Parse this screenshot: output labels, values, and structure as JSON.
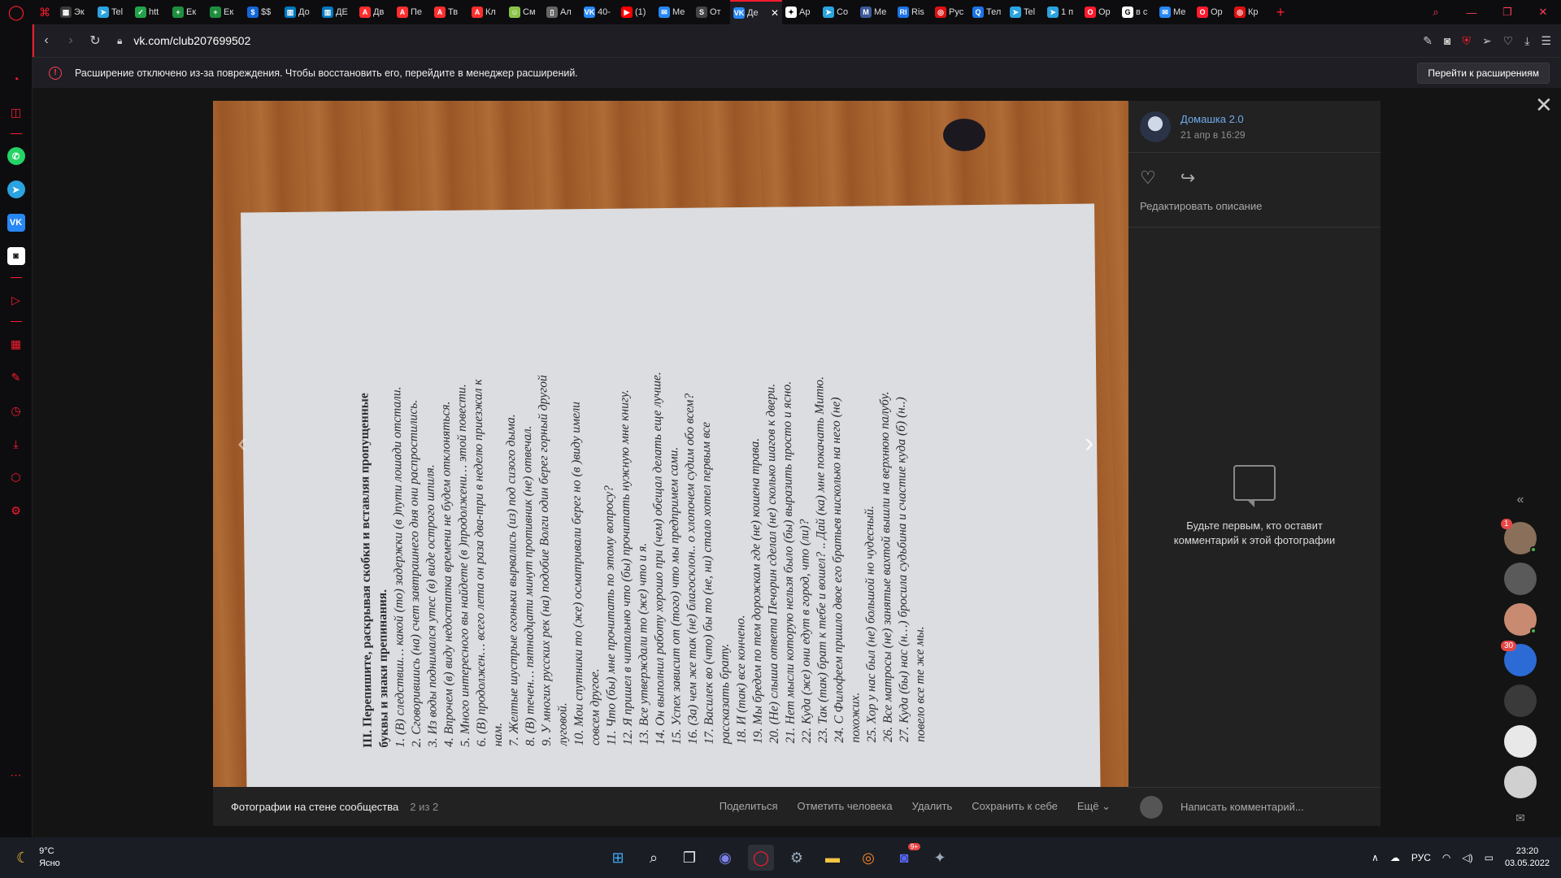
{
  "browser": {
    "tabs": [
      {
        "label": "Эк",
        "color": "#3a3a3a",
        "glyph": "▦"
      },
      {
        "label": "Tel",
        "color": "#2aa3e0",
        "glyph": "➤"
      },
      {
        "label": "htt",
        "color": "#22a34a",
        "glyph": "✓"
      },
      {
        "label": "Ек",
        "color": "#1e8e3e",
        "glyph": "+"
      },
      {
        "label": "Ек",
        "color": "#1e8e3e",
        "glyph": "+"
      },
      {
        "label": "$$",
        "color": "#1467d8",
        "glyph": "$"
      },
      {
        "label": "До",
        "color": "#0079bf",
        "glyph": "▥"
      },
      {
        "label": "ДЕ",
        "color": "#0079bf",
        "glyph": "▥"
      },
      {
        "label": "Дв",
        "color": "#ff2d2d",
        "glyph": "A"
      },
      {
        "label": "Пе",
        "color": "#ff2d2d",
        "glyph": "A"
      },
      {
        "label": "Тв",
        "color": "#ff2d2d",
        "glyph": "A"
      },
      {
        "label": "Кл",
        "color": "#ff2d2d",
        "glyph": "A"
      },
      {
        "label": "См",
        "color": "#8bc34a",
        "glyph": "☺"
      },
      {
        "label": "Ал",
        "color": "#666666",
        "glyph": "▯"
      },
      {
        "label": "40-",
        "color": "#2787f5",
        "glyph": "VK"
      },
      {
        "label": "(1)",
        "color": "#ff0000",
        "glyph": "▶"
      },
      {
        "label": "Ме",
        "color": "#2787f5",
        "glyph": "✉"
      },
      {
        "label": "От",
        "color": "#444444",
        "glyph": "S"
      }
    ],
    "active_tab": {
      "label": "Де",
      "color": "#2787f5",
      "glyph": "VK"
    },
    "tabs_after": [
      {
        "label": "Ар",
        "color": "#ffffff",
        "glyph": "✦"
      },
      {
        "label": "Со",
        "color": "#2aa3e0",
        "glyph": "➤"
      },
      {
        "label": "Ме",
        "color": "#3b5998",
        "glyph": "M"
      },
      {
        "label": "Ris",
        "color": "#1a73e8",
        "glyph": "RI"
      },
      {
        "label": "Рус",
        "color": "#d11",
        "glyph": "◎"
      },
      {
        "label": "Тел",
        "color": "#1a73e8",
        "glyph": "Q"
      },
      {
        "label": "Tel",
        "color": "#2aa3e0",
        "glyph": "➤"
      },
      {
        "label": "1 п",
        "color": "#2aa3e0",
        "glyph": "➤"
      },
      {
        "label": "Ор",
        "color": "#ff1b2d",
        "glyph": "O"
      },
      {
        "label": "в с",
        "color": "#ffffff",
        "glyph": "G"
      },
      {
        "label": "Ме",
        "color": "#2787f5",
        "glyph": "✉"
      },
      {
        "label": "Ор",
        "color": "#ff1b2d",
        "glyph": "O"
      },
      {
        "label": "Кр",
        "color": "#d11",
        "glyph": "◎"
      }
    ],
    "url": "vk.com/club207699502",
    "infobar_text": "Расширение отключено из-за повреждения. Чтобы восстановить его, перейдите в менеджер расширений.",
    "infobar_button": "Перейти к расширениям"
  },
  "viewer": {
    "photo_lines": [
      {
        "text": "III. Перепишите, раскрывая скобки и вставляя пропущенные",
        "head": true
      },
      {
        "text": "буквы и знаки препинания.",
        "head": true
      },
      {
        "text": "1. (В) следствии… какой (то) задержки (в )пути лошади отстали."
      },
      {
        "text": "2. Сговорившись (на) счет завтрашнего дня они распростились."
      },
      {
        "text": "3. Из воды поднимался утес (в) виде острого шпиля."
      },
      {
        "text": "4. Впрочем (в) виду недостатка времени не будем отклоняться."
      },
      {
        "text": "5. Много интересного вы найдете (в )продолжени… этой повести."
      },
      {
        "text": "6. (В) продолжен… всего лета он раза два-три в неделю приезжал к"
      },
      {
        "text": "нам."
      },
      {
        "text": "7. Желтые шустрые огоньки вырвались (из) под сизого дыма."
      },
      {
        "text": "8. (В) течен… пятнадцати минут противник (не) отвечал."
      },
      {
        "text": "9. У многих русских рек (на) подобие Волги один берег горный другой"
      },
      {
        "text": "луговой."
      },
      {
        "text": "10. Мои спутники то (же) осматривали берег но (в )виду имели"
      },
      {
        "text": "совсем другое."
      },
      {
        "text": "11. Что (бы) мне прочитать по этому вопросу?"
      },
      {
        "text": "12. Я пришел в читальню что (бы) прочитать нужную мне книгу."
      },
      {
        "text": "13. Все утверждали то (же) что и я."
      },
      {
        "text": "14. Он выполнил работу хорошо при (чем) обещал делать еще лучше."
      },
      {
        "text": "15. Успех зависит от (того) что мы предпримем сами."
      },
      {
        "text": "16. (За) чем же так (не) благосклон.. о хлопочем судим обо всем?"
      },
      {
        "text": "17. Василек во (что) бы то (не, ни) стало хотел первым все"
      },
      {
        "text": "рассказать брату."
      },
      {
        "text": "18. И (так) все кончено."
      },
      {
        "text": "19. Мы бредем по тем дорожкам где (не) кошена трава."
      },
      {
        "text": "20. (Не) слыша ответа Печорин сделал (не) сколько шагов к двери."
      },
      {
        "text": "21. Нет мысли которую нельзя было (бы) выразить просто и ясно."
      },
      {
        "text": "22. Куда (же) они едут в город, что (ли)?"
      },
      {
        "text": "23. Так (так) брат к тебе и вошел? .. Дай (ка) мне покачать Митю."
      },
      {
        "text": "24. С Филофеем пришло двое его братьев нисколько на него (не)"
      },
      {
        "text": "похожих."
      },
      {
        "text": "25. Хор у нас был (не) большой но чудесный."
      },
      {
        "text": "26. Все матросы (не) занятые вахтой вышли на верхнюю палубу."
      },
      {
        "text": "27. Куда (бы) нас (н…) бросила судьбина и счастие куда (б) (н..)"
      },
      {
        "text": "повело все те же мы."
      }
    ],
    "album_label": "Фотографии на стене сообщества",
    "counter": "2 из 2",
    "actions": [
      "Поделиться",
      "Отметить человека",
      "Удалить",
      "Сохранить к себе",
      "Ещё ⌄"
    ],
    "author_name": "Домашка 2.0",
    "author_date": "21 апр в 16:29",
    "edit_description": "Редактировать описание",
    "empty_comments": "Будьте первым, кто оставит комментарий к этой фотографии",
    "comment_placeholder": "Написать комментарий..."
  },
  "chats": [
    {
      "badge": "1",
      "color": "#8a6f5a",
      "online": true
    },
    {
      "badge": "",
      "color": "#5a5a5a",
      "online": false
    },
    {
      "badge": "",
      "color": "#c98a72",
      "online": true
    },
    {
      "badge": "30",
      "color": "#2c6bd6",
      "online": false
    },
    {
      "badge": "",
      "color": "#3a3a3a",
      "online": false
    },
    {
      "badge": "",
      "color": "#e8e8e8",
      "online": false
    },
    {
      "badge": "",
      "color": "#d0d0d0",
      "online": false
    }
  ],
  "taskbar": {
    "temp": "9°C",
    "weather": "Ясно",
    "lang": "РУС",
    "time": "23:20",
    "date": "03.05.2022",
    "discord_badge": "9+"
  }
}
